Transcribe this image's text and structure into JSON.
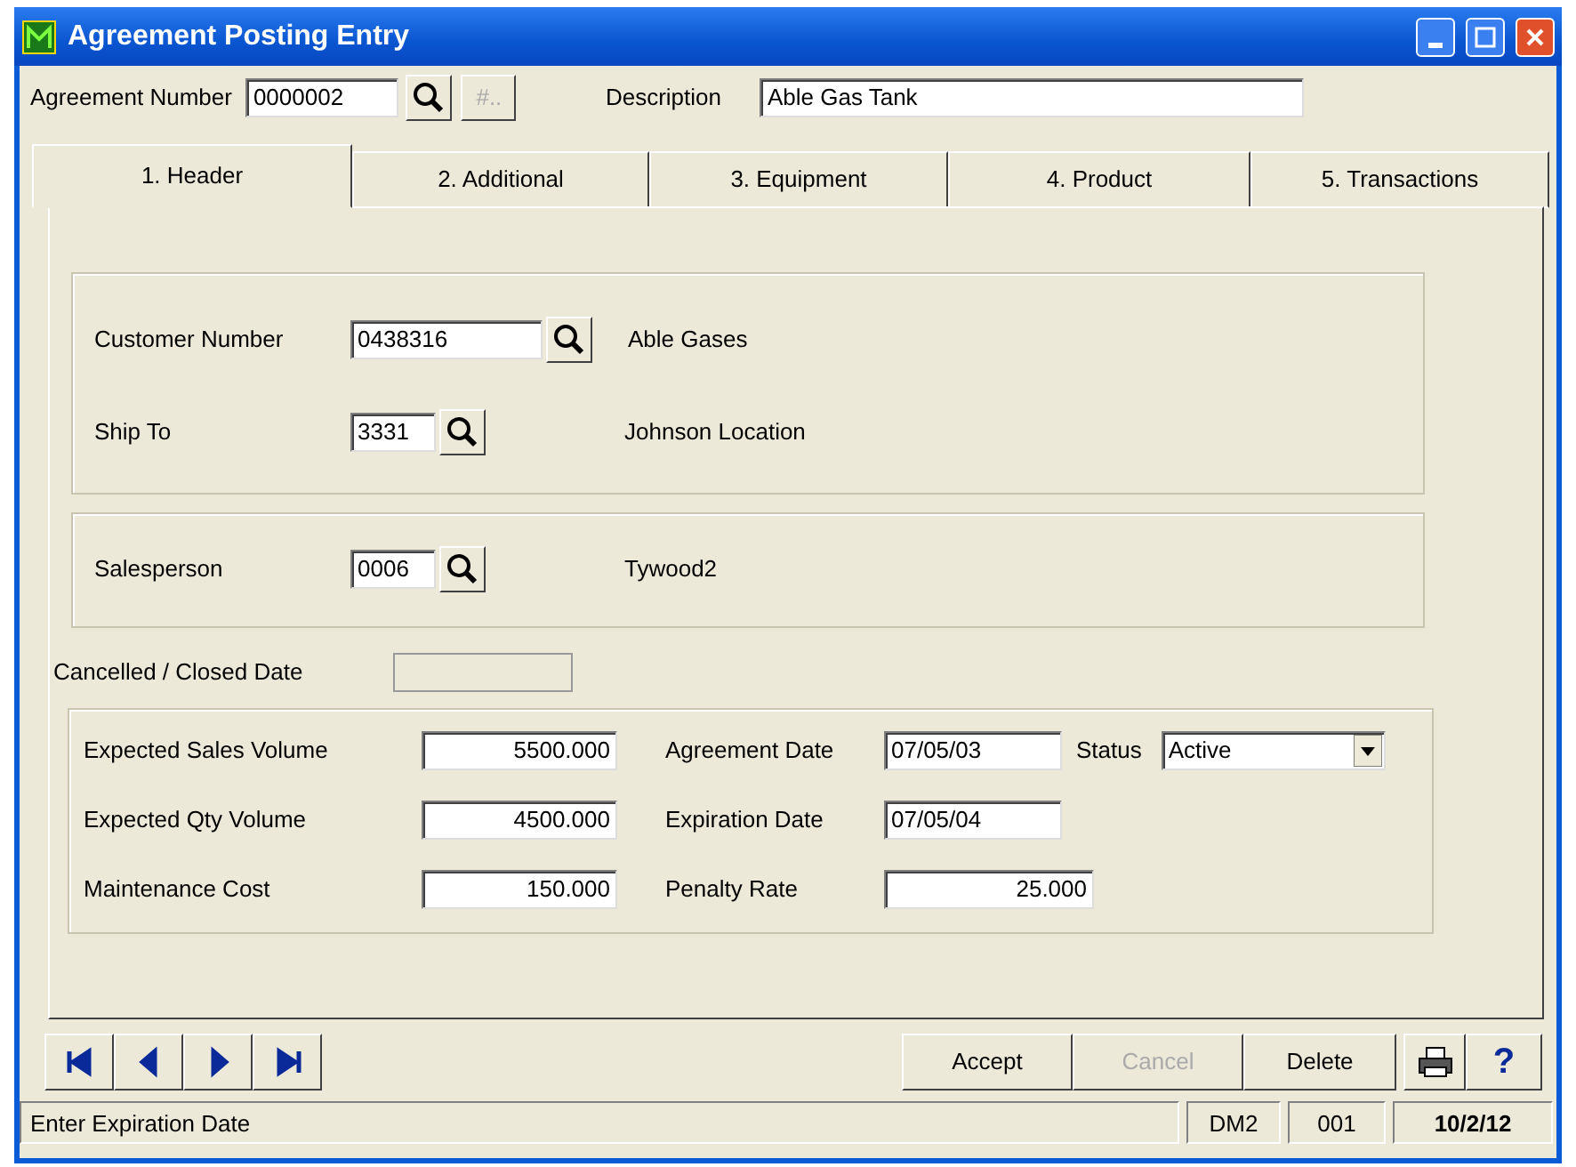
{
  "window": {
    "title": "Agreement Posting Entry"
  },
  "header": {
    "agreement_label": "Agreement Number",
    "agreement_value": "0000002",
    "number_button": "#..",
    "description_label": "Description",
    "description_value": "Able Gas Tank"
  },
  "tabs": [
    {
      "label": "1. Header",
      "selected": true
    },
    {
      "label": "2. Additional",
      "selected": false
    },
    {
      "label": "3. Equipment",
      "selected": false
    },
    {
      "label": "4. Product",
      "selected": false
    },
    {
      "label": "5. Transactions",
      "selected": false
    }
  ],
  "customer_group": [
    {
      "label": "Customer Number",
      "value": "0438316",
      "name": "Able Gases"
    },
    {
      "label": "Ship To",
      "value": "3331",
      "name": "Johnson Location"
    }
  ],
  "sales_group": [
    {
      "label": "Salesperson",
      "value": "0006",
      "name": "Tywood2"
    }
  ],
  "cancelled": {
    "label": "Cancelled / Closed Date",
    "disabled": true
  },
  "amounts": [
    {
      "label": "Expected Sales Volume",
      "value": "5500.000",
      "date_label": "Agreement Date",
      "date_value": "07/05/03"
    },
    {
      "label": "Expected Qty Volume",
      "value": "4500.000",
      "date_label": "Expiration Date",
      "date_value": "07/05/04"
    },
    {
      "label": "Maintenance Cost",
      "value": "150.000",
      "date_label": "Penalty Rate",
      "date_value": "25.000",
      "kind": "number"
    }
  ],
  "status": {
    "label": "Status",
    "value": "Active"
  },
  "actions": [
    {
      "label": "Accept",
      "disabled": false
    },
    {
      "label": "Cancel",
      "disabled": true
    },
    {
      "label": "Delete",
      "disabled": false
    }
  ],
  "help_button": "?",
  "status_bar": {
    "message": "Enter Expiration Date",
    "panels": [
      "DM2",
      "001",
      "10/2/12"
    ]
  }
}
